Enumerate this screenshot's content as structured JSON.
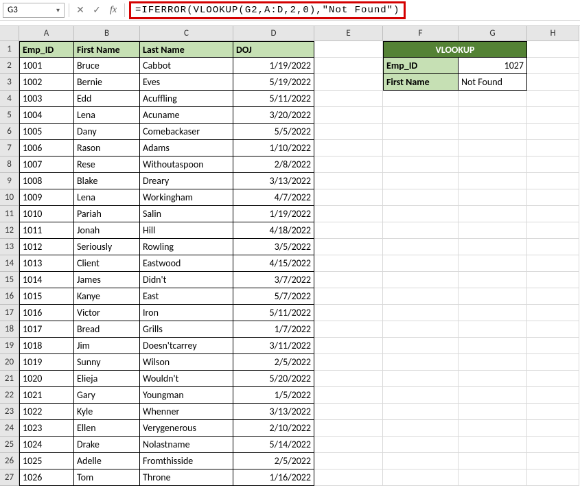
{
  "namebox": "G3",
  "formula": "=IFERROR(VLOOKUP(G2,A:D,2,0),\"Not Found\")",
  "col_headers": [
    "A",
    "B",
    "C",
    "D",
    "E",
    "F",
    "G",
    "H"
  ],
  "row_headers": [
    "1",
    "2",
    "3",
    "4",
    "5",
    "6",
    "7",
    "8",
    "9",
    "10",
    "11",
    "12",
    "13",
    "14",
    "15",
    "16",
    "17",
    "18",
    "19",
    "20",
    "21",
    "22",
    "23",
    "24",
    "25",
    "26",
    "27"
  ],
  "main_headers": [
    "Emp_ID",
    "First Name",
    "Last Name",
    "DOJ"
  ],
  "rows": [
    {
      "id": "1001",
      "fn": "Bruce",
      "ln": "Cabbot",
      "doj": "1/19/2022"
    },
    {
      "id": "1002",
      "fn": "Bernie",
      "ln": "Eves",
      "doj": "5/19/2022"
    },
    {
      "id": "1003",
      "fn": "Edd",
      "ln": "Acuffling",
      "doj": "5/11/2022"
    },
    {
      "id": "1004",
      "fn": "Lena",
      "ln": "Acuname",
      "doj": "3/20/2022"
    },
    {
      "id": "1005",
      "fn": "Dany",
      "ln": "Comebackaser",
      "doj": "5/5/2022"
    },
    {
      "id": "1006",
      "fn": "Rason",
      "ln": "Adams",
      "doj": "1/10/2022"
    },
    {
      "id": "1007",
      "fn": "Rese",
      "ln": "Withoutaspoon",
      "doj": "2/8/2022"
    },
    {
      "id": "1008",
      "fn": "Blake",
      "ln": "Dreary",
      "doj": "3/13/2022"
    },
    {
      "id": "1009",
      "fn": "Lena",
      "ln": "Workingham",
      "doj": "4/7/2022"
    },
    {
      "id": "1010",
      "fn": "Pariah",
      "ln": "Salin",
      "doj": "1/19/2022"
    },
    {
      "id": "1011",
      "fn": "Jonah",
      "ln": "Hill",
      "doj": "4/18/2022"
    },
    {
      "id": "1012",
      "fn": "Seriously",
      "ln": "Rowling",
      "doj": "3/5/2022"
    },
    {
      "id": "1013",
      "fn": "Client",
      "ln": "Eastwood",
      "doj": "4/15/2022"
    },
    {
      "id": "1014",
      "fn": "James",
      "ln": "Didn't",
      "doj": "3/7/2022"
    },
    {
      "id": "1015",
      "fn": "Kanye",
      "ln": "East",
      "doj": "5/7/2022"
    },
    {
      "id": "1016",
      "fn": "Victor",
      "ln": "Iron",
      "doj": "5/11/2022"
    },
    {
      "id": "1017",
      "fn": "Bread",
      "ln": "Grills",
      "doj": "1/7/2022"
    },
    {
      "id": "1018",
      "fn": "Jim",
      "ln": "Doesn'tcarrey",
      "doj": "3/11/2022"
    },
    {
      "id": "1019",
      "fn": "Sunny",
      "ln": "Wilson",
      "doj": "2/5/2022"
    },
    {
      "id": "1020",
      "fn": "Elieja",
      "ln": "Wouldn't",
      "doj": "5/20/2022"
    },
    {
      "id": "1021",
      "fn": "Gary",
      "ln": "Youngman",
      "doj": "1/5/2022"
    },
    {
      "id": "1022",
      "fn": "Kyle",
      "ln": "Whenner",
      "doj": "3/13/2022"
    },
    {
      "id": "1023",
      "fn": "Ellen",
      "ln": "Verygenerous",
      "doj": "2/10/2022"
    },
    {
      "id": "1024",
      "fn": "Drake",
      "ln": "Nolastname",
      "doj": "5/14/2022"
    },
    {
      "id": "1025",
      "fn": "Adelle",
      "ln": "Fromthisside",
      "doj": "2/5/2022"
    },
    {
      "id": "1026",
      "fn": "Tom",
      "ln": "Throne",
      "doj": "1/16/2022"
    }
  ],
  "vlookup": {
    "title": "VLOOKUP",
    "emp_id_label": "Emp_ID",
    "emp_id_value": "1027",
    "first_name_label": "First Name",
    "first_name_value": "Not Found"
  }
}
